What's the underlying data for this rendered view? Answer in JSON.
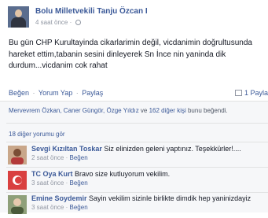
{
  "post": {
    "author": "Bolu Milletvekili Tanju Özcan I",
    "time": "4 saat önce",
    "meta_sep": "·",
    "text": "Bu gün CHP Kurultayinda cikarlarimin değil, vicdanimin doğrultusunda hareket ettim,tabanin sesini dinleyerek Sn İnce nin yaninda dik durdum...vicdanim cok rahat"
  },
  "actions": {
    "like": "Beğen",
    "comment": "Yorum Yap",
    "share": "Paylaş",
    "sep": "·",
    "share_count": "1 Payla"
  },
  "feedback": {
    "likes_names": "Mervevrem Özkan, Caner Güngör, Özge Yıldız",
    "likes_mid": " ve ",
    "likes_others": "162 diğer kişi",
    "likes_end": " bunu beğendi.",
    "more_comments": "18 diğer yorumu gör"
  },
  "comments": [
    {
      "name": "Sevgi Kızıltan Toskar",
      "text": "Siz elinizden geleni yaptınız. Teşekkürler!....",
      "time": "2 saat önce",
      "like": "Beğen"
    },
    {
      "name": "TC Oya Kurt",
      "text": "Bravo size kutluyorum vekilim.",
      "time": "3 saat önce",
      "like": "Beğen"
    },
    {
      "name": "Emine Soydemir",
      "text": "Sayin vekilim sizinle birlikte dimdik hep yaninizdayiz",
      "time": "3 saat önce",
      "like": "Beğen"
    }
  ],
  "colors": {
    "link": "#3b5998",
    "muted": "#9197a3",
    "feedback_bg": "#f6f7f9"
  },
  "icons": [
    "globe-icon",
    "share-icon"
  ]
}
